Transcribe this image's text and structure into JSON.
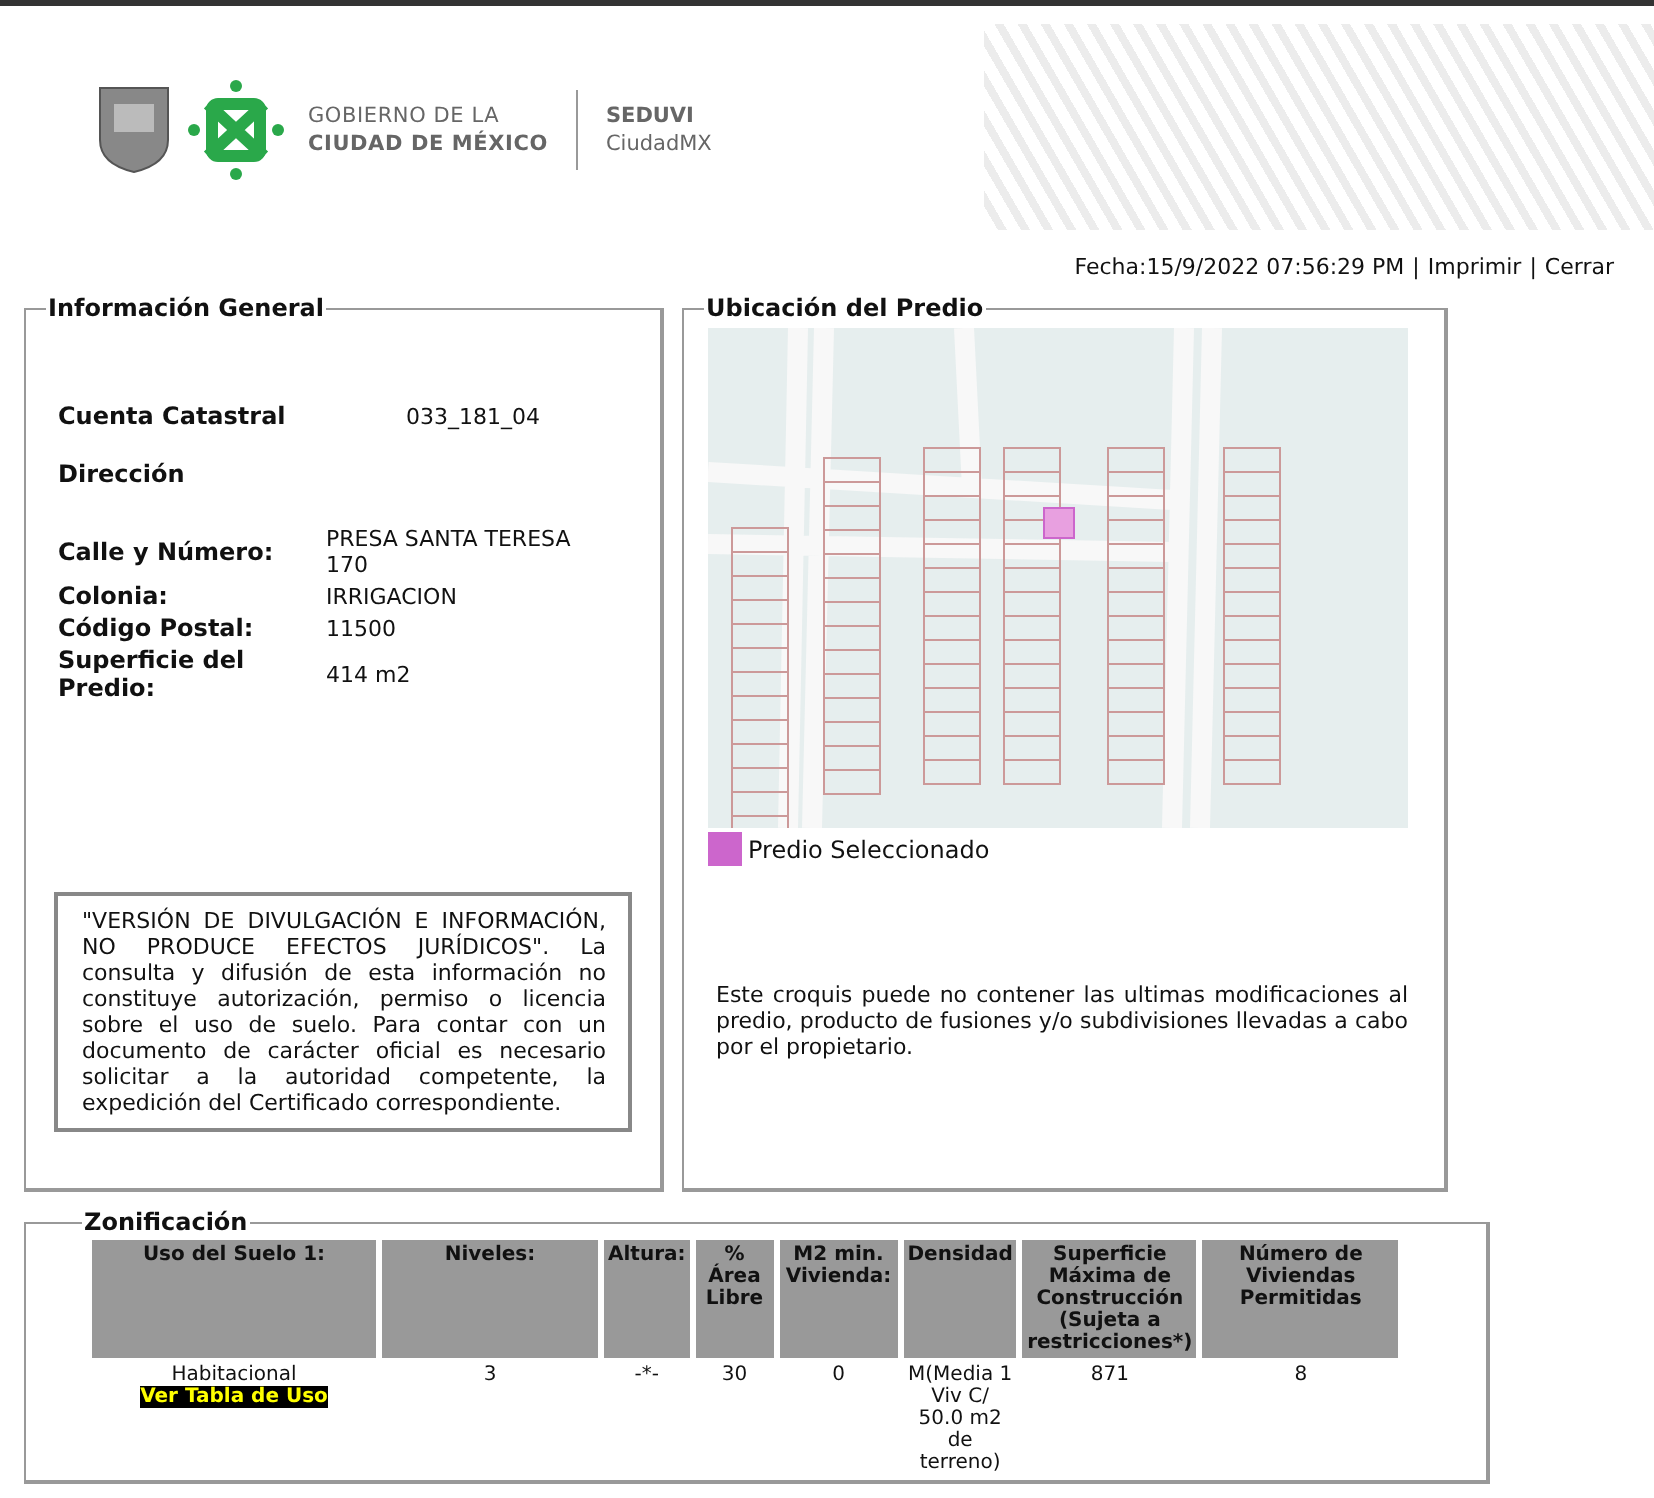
{
  "header": {
    "brand_lines": [
      "GOBIERNO DE LA",
      "CIUDAD DE MÉXICO"
    ],
    "agency": "SEDUVI",
    "agency_sub": "CiudadMX"
  },
  "toolbar": {
    "date": "Fecha:15/9/2022 07:56:29 PM",
    "separator": "|",
    "links": [
      "Imprimir",
      "Cerrar"
    ]
  },
  "info_general": {
    "title": "Información General",
    "account": {
      "label": "Cuenta Catastral",
      "value": "033_181_04"
    },
    "address_title": "Dirección",
    "fields": [
      {
        "label": "Calle y Número:",
        "value": "PRESA SANTA TERESA 170"
      },
      {
        "label": "Colonia:",
        "value": "IRRIGACION"
      },
      {
        "label": "Código Postal:",
        "value": "11500"
      },
      {
        "label": "Superficie del Predio:",
        "value": "414 m2"
      }
    ],
    "disclaimer": "\"VERSIÓN DE DIVULGACIÓN E INFORMACIÓN, NO PRODUCE EFECTOS JURÍDICOS\". La consulta y difusión de esta información no constituye autorización, permiso o licencia sobre el uso de suelo. Para contar con un documento de carácter oficial es necesario solicitar a la autoridad competente, la expedición del Certificado correspondiente."
  },
  "ubicacion": {
    "title": "Ubicación del Predio",
    "legend": {
      "label": "Predio Seleccionado",
      "color": "#cc66cc"
    },
    "note": "Este croquis puede no contener las ultimas modificaciones al predio, producto de fusiones y/o subdivisiones llevadas a cabo por el propietario."
  },
  "zonificacion": {
    "title": "Zonificación",
    "columns": [
      "Uso del Suelo 1:",
      "Niveles:",
      "Altura:",
      "% Área Libre",
      "M2 min. Vivienda:",
      "Densidad",
      "Superficie Máxima de Construcción (Sujeta a restricciones*)",
      "Número de Viviendas Permitidas"
    ],
    "rows": [
      {
        "cells": [
          "Habitacional",
          "3",
          "-*-",
          "30",
          "0",
          "M(Media 1 Viv C/ 50.0 m2 de terreno)",
          "871",
          "8"
        ],
        "link": "Ver Tabla de Uso"
      }
    ]
  }
}
